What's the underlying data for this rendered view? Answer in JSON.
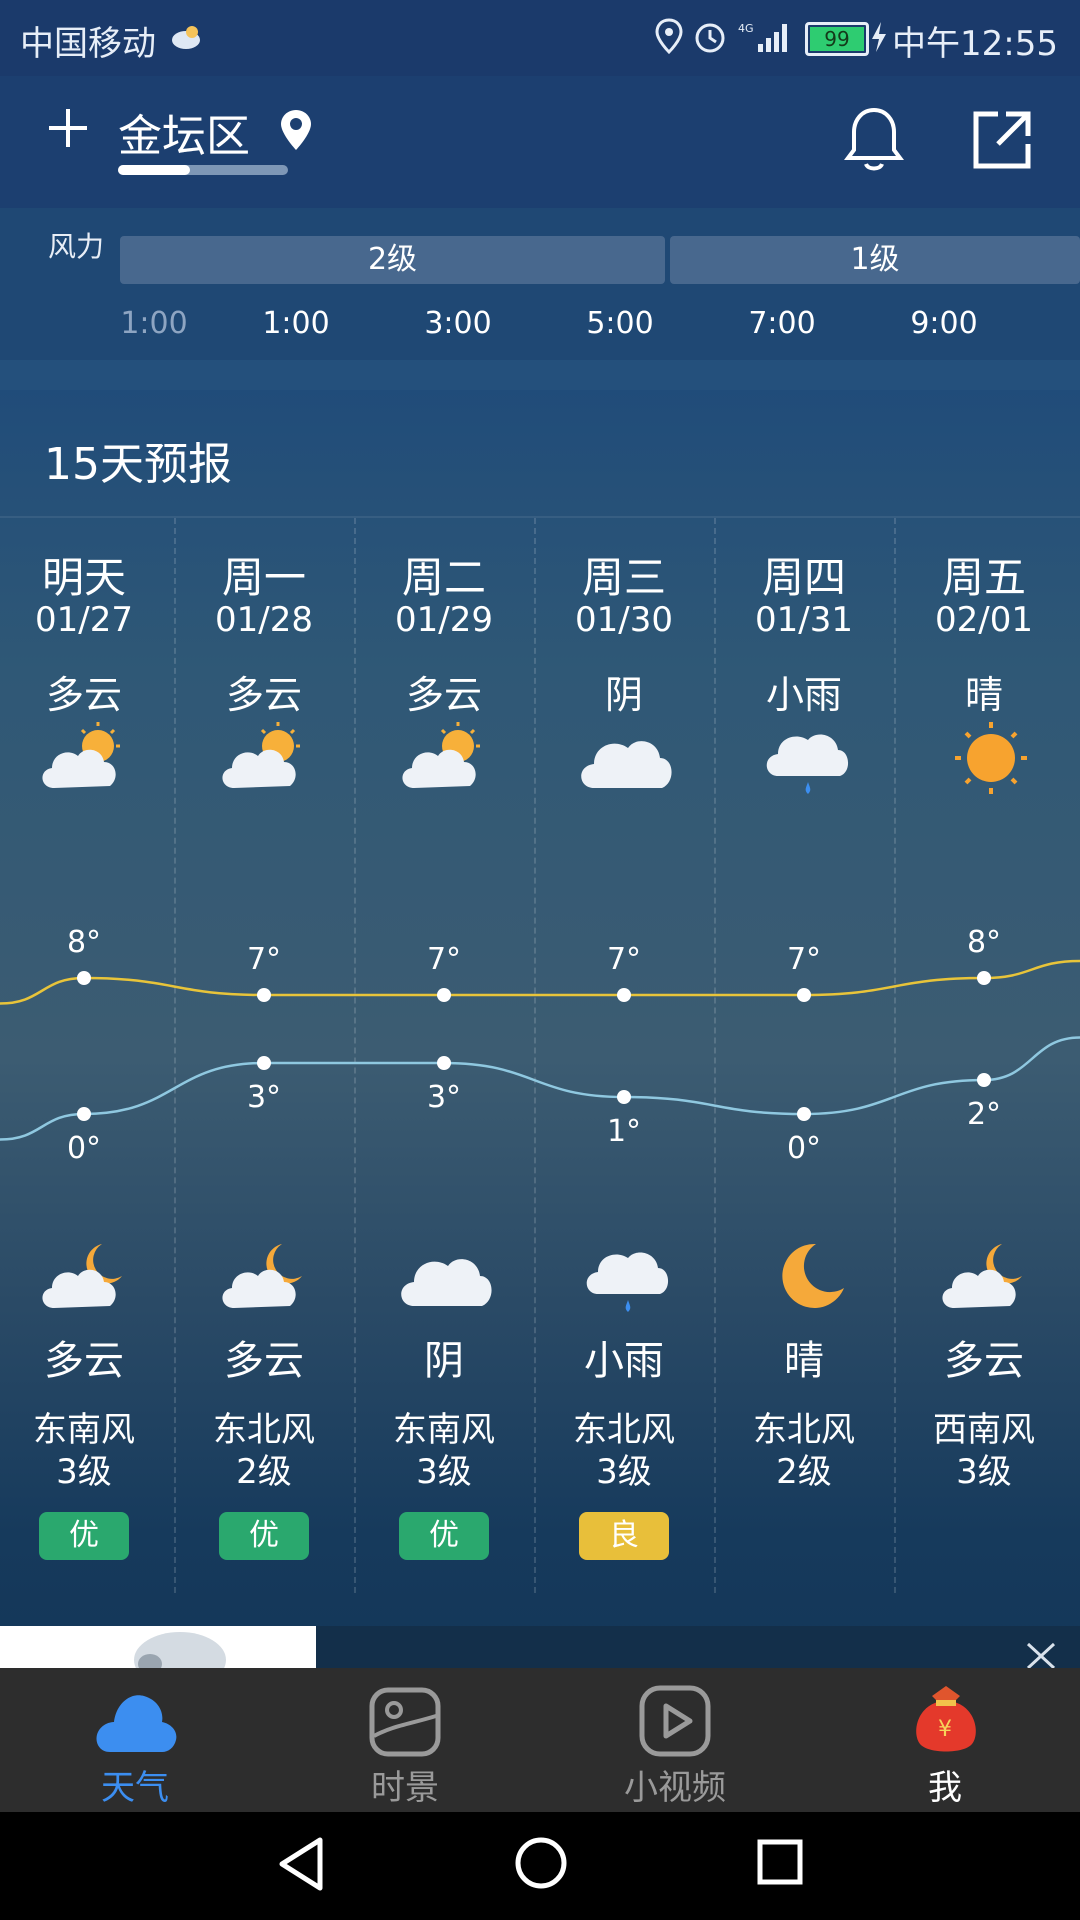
{
  "status_bar": {
    "carrier": "中国移动",
    "battery": "99",
    "time": "中午12:55"
  },
  "header": {
    "city": "金坛区"
  },
  "wind": {
    "label": "风力",
    "segments": [
      "2级",
      "1级"
    ],
    "hours": [
      "1:00",
      "1:00",
      "3:00",
      "5:00",
      "7:00",
      "9:00"
    ]
  },
  "forecast": {
    "title": "15天预报",
    "days": [
      {
        "name": "明天",
        "date": "01/27",
        "day_weather": "多云",
        "day_icon": "partly-cloudy-day-icon",
        "high": "8°",
        "low": "0°",
        "night_weather": "多云",
        "night_icon": "partly-cloudy-night-icon",
        "wind_dir": "东南风",
        "wind_level": "3级",
        "aqi": "优",
        "aqi_color": "#2aa86e"
      },
      {
        "name": "周一",
        "date": "01/28",
        "day_weather": "多云",
        "day_icon": "partly-cloudy-day-icon",
        "high": "7°",
        "low": "3°",
        "night_weather": "多云",
        "night_icon": "partly-cloudy-night-icon",
        "wind_dir": "东北风",
        "wind_level": "2级",
        "aqi": "优",
        "aqi_color": "#2aa86e"
      },
      {
        "name": "周二",
        "date": "01/29",
        "day_weather": "多云",
        "day_icon": "partly-cloudy-day-icon",
        "high": "7°",
        "low": "3°",
        "night_weather": "阴",
        "night_icon": "cloud-icon",
        "wind_dir": "东南风",
        "wind_level": "3级",
        "aqi": "优",
        "aqi_color": "#2aa86e"
      },
      {
        "name": "周三",
        "date": "01/30",
        "day_weather": "阴",
        "day_icon": "cloud-icon",
        "high": "7°",
        "low": "1°",
        "night_weather": "小雨",
        "night_icon": "light-rain-icon",
        "wind_dir": "东北风",
        "wind_level": "3级",
        "aqi": "良",
        "aqi_color": "#e8bf3a"
      },
      {
        "name": "周四",
        "date": "01/31",
        "day_weather": "小雨",
        "day_icon": "light-rain-icon",
        "high": "7°",
        "low": "0°",
        "night_weather": "晴",
        "night_icon": "moon-icon",
        "wind_dir": "东北风",
        "wind_level": "2级",
        "aqi": "",
        "aqi_color": ""
      },
      {
        "name": "周五",
        "date": "02/01",
        "day_weather": "晴",
        "day_icon": "sun-icon",
        "high": "8°",
        "low": "2°",
        "night_weather": "多云",
        "night_icon": "partly-cloudy-night-icon",
        "wind_dir": "西南风",
        "wind_level": "3级",
        "aqi": "",
        "aqi_color": ""
      }
    ]
  },
  "tabs": [
    {
      "label": "天气",
      "icon": "cloud-icon",
      "active": true,
      "color": "#3c8ef0"
    },
    {
      "label": "时景",
      "icon": "landscape-icon",
      "active": false,
      "color": "#9a9a9a"
    },
    {
      "label": "小视频",
      "icon": "play-icon",
      "active": false,
      "color": "#9a9a9a"
    },
    {
      "label": "我",
      "icon": "lucky-bag-icon",
      "active": false,
      "color": "#ffffff"
    }
  ],
  "ad": {
    "close_icon": "close-icon"
  }
}
